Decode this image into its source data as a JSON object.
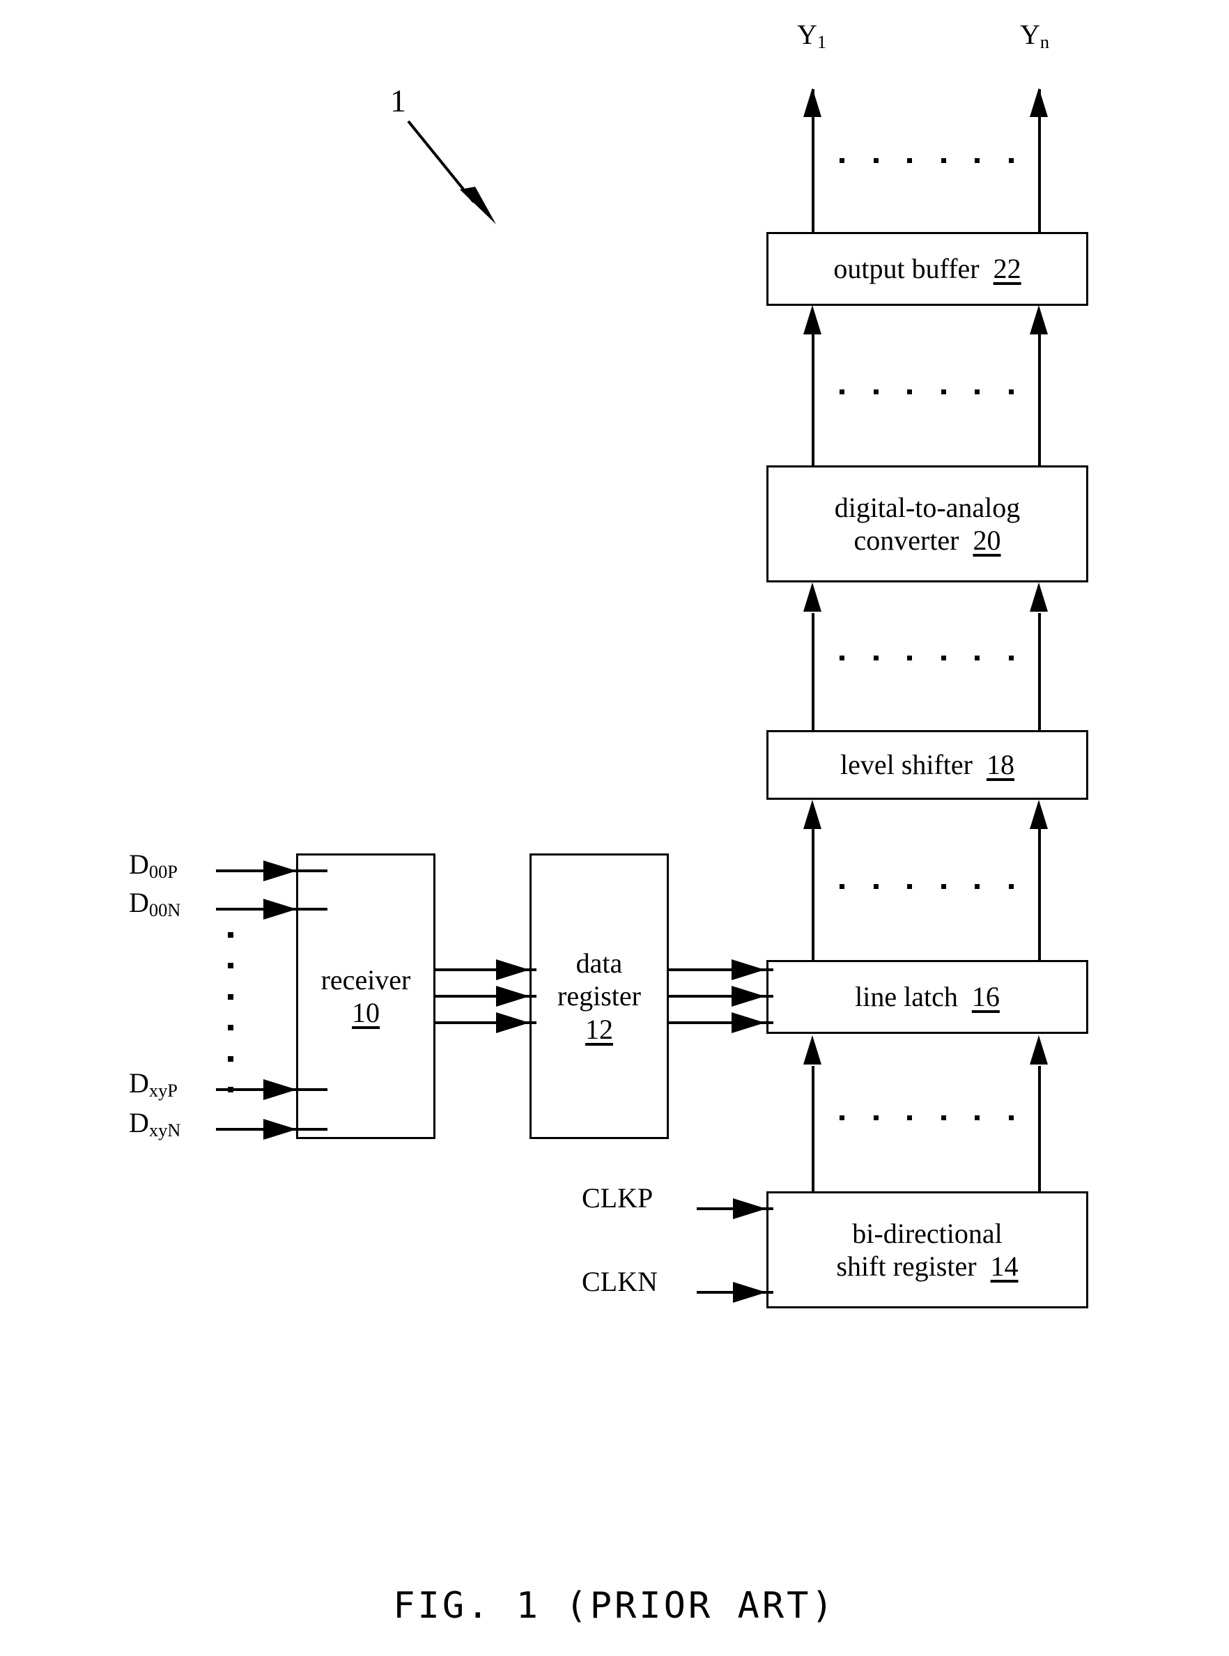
{
  "figure": {
    "reference_numeral": "1",
    "caption": "FIG. 1 (PRIOR ART)"
  },
  "outputs": {
    "first": "Y",
    "first_sub": "1",
    "last": "Y",
    "last_sub": "n"
  },
  "blocks": [
    {
      "id": "output-buffer",
      "line1": "output buffer",
      "line2": "",
      "numeral": "22"
    },
    {
      "id": "digital-to-analog",
      "line1": "digital-to-analog",
      "line2": "converter",
      "numeral": "20"
    },
    {
      "id": "level-shifter",
      "line1": "level shifter",
      "line2": "",
      "numeral": "18"
    },
    {
      "id": "line-latch",
      "line1": "line latch",
      "line2": "",
      "numeral": "16"
    },
    {
      "id": "bidirectional-shift-register",
      "line1": "bi-directional",
      "line2": "shift register",
      "numeral": "14"
    },
    {
      "id": "receiver",
      "line1": "receiver",
      "line2": "",
      "numeral": "10"
    },
    {
      "id": "data-register",
      "line1": "data",
      "line2": "register",
      "numeral": "12"
    }
  ],
  "inputs": {
    "data": [
      {
        "name": "D",
        "sub": "00P"
      },
      {
        "name": "D",
        "sub": "00N"
      },
      {
        "name": "D",
        "sub": "xyP"
      },
      {
        "name": "D",
        "sub": "xyN"
      }
    ],
    "clocks": [
      {
        "label": "CLKP"
      },
      {
        "label": "CLKN"
      }
    ]
  },
  "ellipsis": {
    "horizontal_dot_count": 6,
    "vertical_dot_count": 6
  },
  "colors": {
    "ink": "#000000",
    "background": "#ffffff"
  }
}
